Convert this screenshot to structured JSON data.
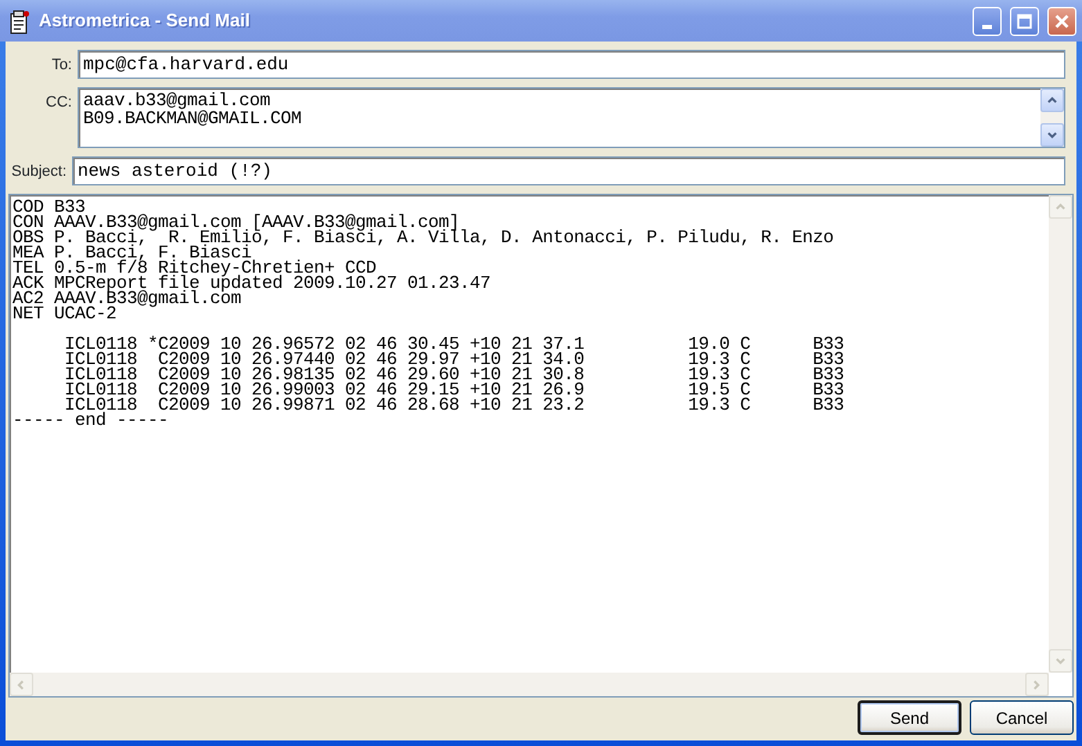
{
  "window": {
    "title": "Astrometrica - Send Mail"
  },
  "to": {
    "label": "To:",
    "value": "mpc@cfa.harvard.edu"
  },
  "cc": {
    "label": "CC:",
    "lines": [
      "aaav.b33@gmail.com",
      "B09.BACKMAN@GMAIL.COM"
    ]
  },
  "subject": {
    "label": "Subject:",
    "value": "news asteroid (!?)"
  },
  "body": {
    "lines": [
      "COD B33",
      "CON AAAV.B33@gmail.com [AAAV.B33@gmail.com]",
      "OBS P. Bacci,  R. Emilio, F. Biasci, A. Villa, D. Antonacci, P. Piludu, R. Enzo",
      "MEA P. Bacci, F. Biasci",
      "TEL 0.5-m f/8 Ritchey-Chretien+ CCD",
      "ACK MPCReport file updated 2009.10.27 01.23.47",
      "AC2 AAAV.B33@gmail.com",
      "NET UCAC-2"
    ],
    "observations": [
      "     ICL0118 *C2009 10 26.96572 02 46 30.45 +10 21 37.1          19.0 C      B33",
      "     ICL0118  C2009 10 26.97440 02 46 29.97 +10 21 34.0          19.3 C      B33",
      "     ICL0118  C2009 10 26.98135 02 46 29.60 +10 21 30.8          19.3 C      B33",
      "     ICL0118  C2009 10 26.99003 02 46 29.15 +10 21 26.9          19.5 C      B33",
      "     ICL0118  C2009 10 26.99871 02 46 28.68 +10 21 23.2          19.3 C      B33"
    ],
    "footer": "----- end -----"
  },
  "buttons": [
    {
      "label": "Send",
      "default": true
    },
    {
      "label": "Cancel",
      "default": false
    }
  ]
}
